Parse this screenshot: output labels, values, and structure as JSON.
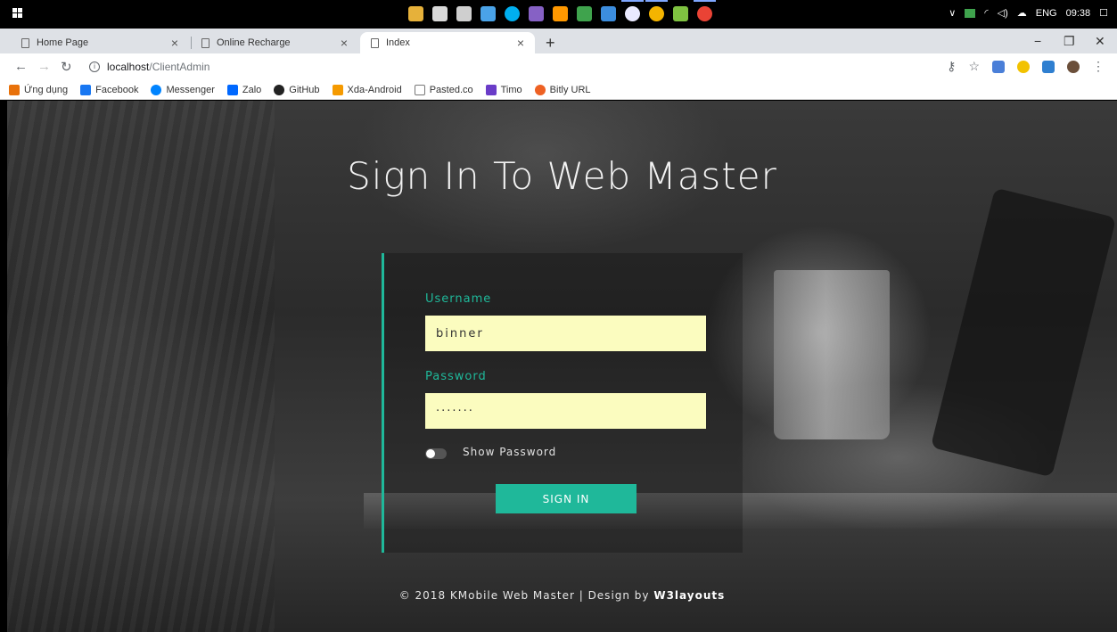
{
  "taskbar": {
    "lang": "ENG",
    "time": "09:38",
    "apps": [
      "file-explorer",
      "app-2",
      "app-3",
      "app-4",
      "skype",
      "visual-studio",
      "sublime",
      "app-8",
      "app-9",
      "app-10",
      "chrome",
      "app-12",
      "chrome-2"
    ]
  },
  "tabs": [
    {
      "label": "Home Page"
    },
    {
      "label": "Online Recharge"
    },
    {
      "label": "Index"
    }
  ],
  "address": {
    "host": "localhost",
    "path": "/ClientAdmin"
  },
  "bookmarks": [
    {
      "label": "Ứng dụng",
      "icon": "apps-icon",
      "color": "#e8710a"
    },
    {
      "label": "Facebook",
      "icon": "facebook-icon",
      "color": "#1877f2"
    },
    {
      "label": "Messenger",
      "icon": "messenger-icon",
      "color": "#0084ff"
    },
    {
      "label": "Zalo",
      "icon": "zalo-icon",
      "color": "#0068ff"
    },
    {
      "label": "GitHub",
      "icon": "github-icon",
      "color": "#222222"
    },
    {
      "label": "Xda-Android",
      "icon": "xda-icon",
      "color": "#f59a00"
    },
    {
      "label": "Pasted.co",
      "icon": "page-icon",
      "color": "#888888"
    },
    {
      "label": "Timo",
      "icon": "timo-icon",
      "color": "#6a3cc8"
    },
    {
      "label": "Bitly URL",
      "icon": "bitly-icon",
      "color": "#ee6123"
    }
  ],
  "page": {
    "title": "Sign In To Web Master",
    "username_label": "Username",
    "username_value": "binner",
    "password_label": "Password",
    "password_value": "·······",
    "show_password_label": "Show Password",
    "signin_label": "SIGN IN",
    "footer_text": "© 2018 KMobile Web Master | Design by ",
    "footer_brand": "W3layouts",
    "accent_color": "#1fb89a",
    "field_color": "#fbfcbf"
  }
}
